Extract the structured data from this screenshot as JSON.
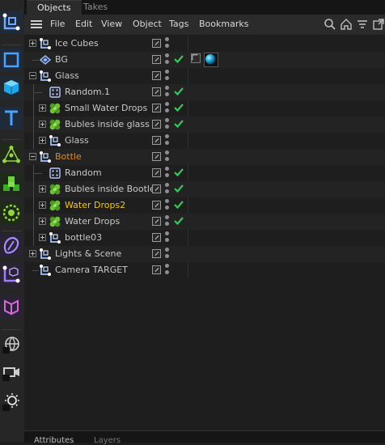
{
  "tabs": [
    {
      "label": "Objects",
      "active": true
    },
    {
      "label": "Takes",
      "active": false
    }
  ],
  "menu": [
    "File",
    "Edit",
    "View",
    "Object",
    "Tags",
    "Bookmarks"
  ],
  "toolbar_icons": [
    "search-icon",
    "home-icon",
    "filter-icon",
    "new-window-icon"
  ],
  "palette_icons": [
    "null-object-icon",
    "cube-primitive-icon",
    "cube-3d-icon",
    "text-spline-icon",
    "mograph-cloner-icon",
    "matrix-icon",
    "effector-icon",
    "deformer-icon",
    "null-cube-icon",
    "mograph-fracture-icon",
    "scene-globe-icon",
    "camera-icon",
    "light-icon"
  ],
  "objects": [
    {
      "name": "Ice Cubes",
      "indent": 0,
      "expander": "plus",
      "icon": "null",
      "check": false,
      "color": "#c8c8c8"
    },
    {
      "name": "BG",
      "indent": 0,
      "expander": "none",
      "icon": "bg",
      "check": true,
      "color": "#c8c8c8",
      "tags": true
    },
    {
      "name": "Glass",
      "indent": 0,
      "expander": "minus",
      "icon": "null",
      "check": false,
      "color": "#c8c8c8"
    },
    {
      "name": "Random.1",
      "indent": 1,
      "expander": "none",
      "icon": "random",
      "check": true,
      "color": "#c8c8c8"
    },
    {
      "name": "Small Water Drops",
      "indent": 1,
      "expander": "plus",
      "icon": "cloner",
      "check": true,
      "color": "#c8c8c8"
    },
    {
      "name": "Bubles inside glass",
      "indent": 1,
      "expander": "plus",
      "icon": "cloner",
      "check": true,
      "color": "#c8c8c8"
    },
    {
      "name": "Glass",
      "indent": 1,
      "expander": "plus",
      "icon": "null",
      "check": false,
      "color": "#c8c8c8"
    },
    {
      "name": "Bottle",
      "indent": 0,
      "expander": "minus",
      "icon": "null",
      "check": false,
      "color": "#e0882f"
    },
    {
      "name": "Random",
      "indent": 1,
      "expander": "none",
      "icon": "random",
      "check": true,
      "color": "#c8c8c8"
    },
    {
      "name": "Bubles inside Bootle",
      "indent": 1,
      "expander": "plus",
      "icon": "cloner",
      "check": true,
      "color": "#c8c8c8"
    },
    {
      "name": "Water Drops2",
      "indent": 1,
      "expander": "plus",
      "icon": "cloner",
      "check": true,
      "color": "#f5c518"
    },
    {
      "name": "Water Drops",
      "indent": 1,
      "expander": "plus",
      "icon": "cloner",
      "check": true,
      "color": "#c8c8c8"
    },
    {
      "name": "bottle03",
      "indent": 1,
      "expander": "plus",
      "icon": "null",
      "check": false,
      "color": "#c8c8c8"
    },
    {
      "name": "Lights & Scene",
      "indent": 0,
      "expander": "plus",
      "icon": "null",
      "check": false,
      "color": "#c8c8c8"
    },
    {
      "name": "Camera TARGET",
      "indent": 0,
      "expander": "none",
      "icon": "null",
      "check": false,
      "color": "#c8c8c8"
    }
  ],
  "bottom_tabs": [
    "Attributes",
    "Layers"
  ],
  "colors": {
    "accent_check": "#3ec45a",
    "selected_text": "#f5c518",
    "group_text": "#e0882f"
  }
}
